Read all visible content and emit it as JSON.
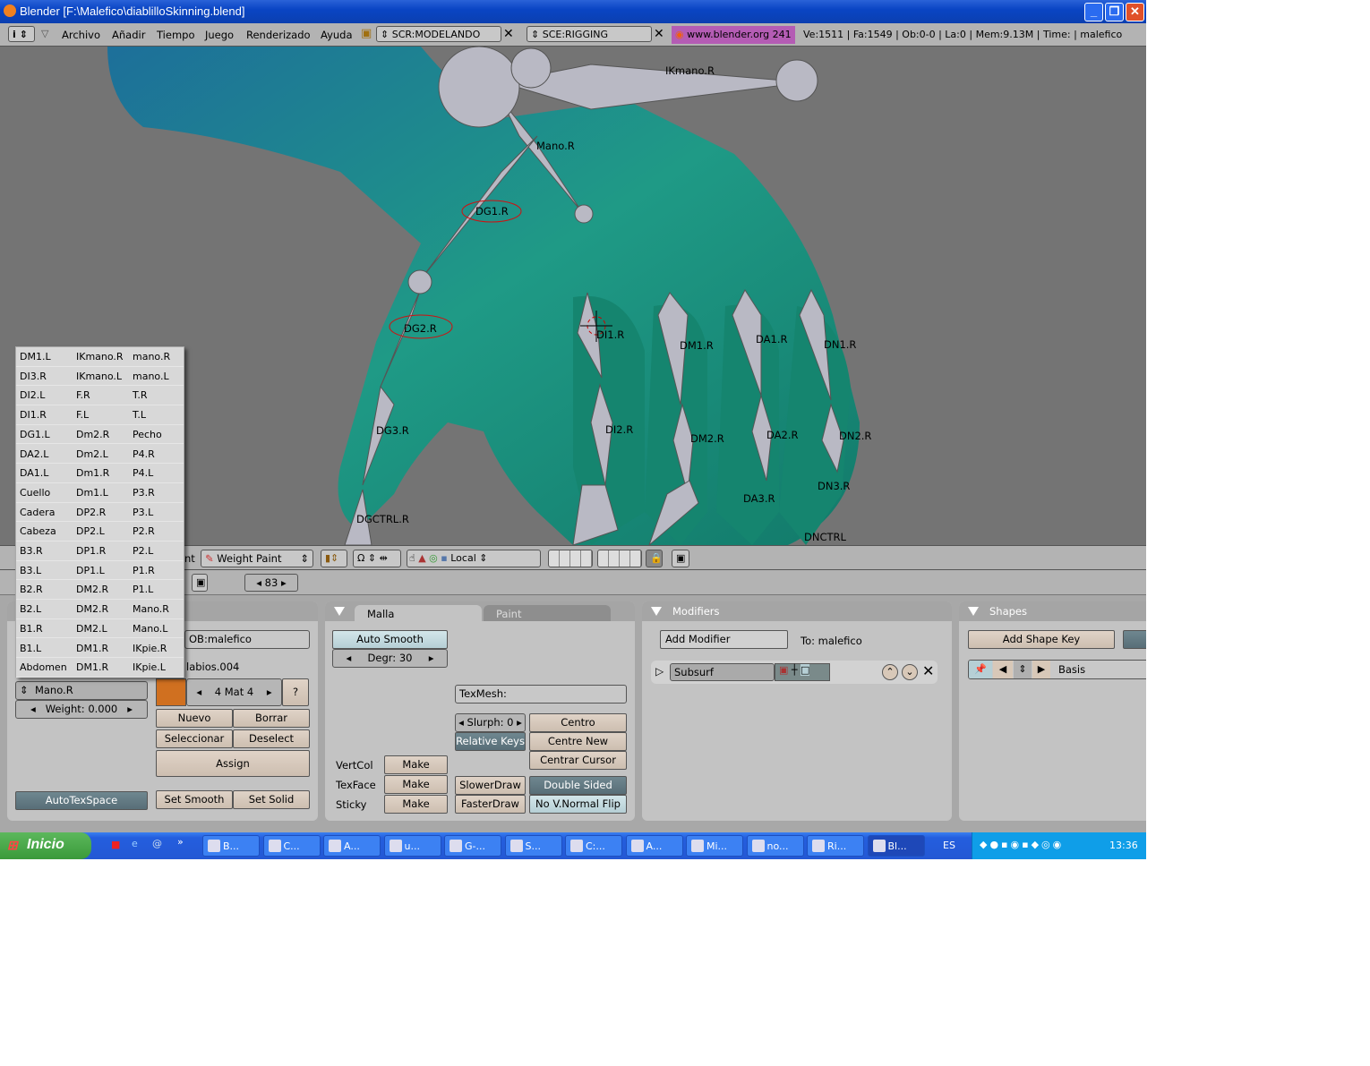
{
  "window": {
    "title": "Blender [F:\\Malefico\\diablilloSkinning.blend]",
    "buttons": [
      "minimize",
      "restore",
      "close"
    ]
  },
  "menubar": {
    "items": [
      "Archivo",
      "Añadir",
      "Tiempo",
      "Juego",
      "Renderizado",
      "Ayuda"
    ],
    "screen": "SCR:MODELANDO",
    "scene": "SCE:RIGGING",
    "link": "www.blender.org 241",
    "stats": "Ve:1511 | Fa:1549 | Ob:0-0 | La:0 | Mem:9.13M | Time: | malefico",
    "link_color": "#b45cb4"
  },
  "viewport": {
    "background": "#747474",
    "mesh_color": "#1f8a8a",
    "bones": [
      "IKmano.R",
      "Mano.R",
      "DG1.R",
      "DG2.R",
      "DI1.R",
      "DM1.R",
      "DA1.R",
      "DN1.R",
      "DG3.R",
      "DI2.R",
      "DM2.R",
      "DA2.R",
      "DN2.R",
      "DGCTRL.R",
      "DA3.R",
      "DN3.R",
      "DNCTRL"
    ]
  },
  "header3d": {
    "mode_partial": "nt",
    "mode": "Weight Paint",
    "orientation": "Local"
  },
  "buttons_header": {
    "frame": "83"
  },
  "popup": {
    "rows": [
      [
        "DM1.L",
        "IKmano.R",
        "mano.R"
      ],
      [
        "DI3.R",
        "IKmano.L",
        "mano.L"
      ],
      [
        "DI2.L",
        "F.R",
        "T.R"
      ],
      [
        "DI1.R",
        "F.L",
        "T.L"
      ],
      [
        "DG1.L",
        "Dm2.R",
        "Pecho"
      ],
      [
        "DA2.L",
        "Dm2.L",
        "P4.R"
      ],
      [
        "DA1.L",
        "Dm1.R",
        "P4.L"
      ],
      [
        "Cuello",
        "Dm1.L",
        "P3.R"
      ],
      [
        "Cadera",
        "DP2.R",
        "P3.L"
      ],
      [
        "Cabeza",
        "DP2.L",
        "P2.R"
      ],
      [
        "B3.R",
        "DP1.R",
        "P2.L"
      ],
      [
        "B3.L",
        "DP1.L",
        "P1.R"
      ],
      [
        "B2.R",
        "DM2.R",
        "P1.L"
      ],
      [
        "B2.L",
        "DM2.R",
        "Mano.R"
      ],
      [
        "B1.R",
        "DM2.L",
        "Mano.L"
      ],
      [
        "B1.L",
        "DM1.R",
        "IKpie.R"
      ],
      [
        "Abdomen",
        "DM1.R",
        "IKpie.L"
      ]
    ]
  },
  "link_panel": {
    "ob": "OB:malefico",
    "material_name": "labios.004",
    "mat": "4 Mat 4",
    "mat_help": "?",
    "material_color": "#d07020",
    "vgroup": "Mano.R",
    "weight": "Weight: 0.000",
    "nuevo": "Nuevo",
    "borrar": "Borrar",
    "seleccionar": "Seleccionar",
    "deselect": "Deselect",
    "assign": "Assign",
    "autotex": "AutoTexSpace",
    "set_smooth": "Set Smooth",
    "set_solid": "Set Solid"
  },
  "mesh_panel": {
    "tab_active": "Malla",
    "tab_inactive": "Paint",
    "auto_smooth": "Auto Smooth",
    "degr": "Degr: 30",
    "texmesh": "TexMesh:",
    "slurph": "Slurph: 0",
    "relative_keys": "Relative Keys",
    "centro": "Centro",
    "centre_new": "Centre New",
    "centrar_cursor": "Centrar Cursor",
    "vertcol": "VertCol",
    "texface": "TexFace",
    "sticky": "Sticky",
    "make": "Make",
    "slower": "SlowerDraw",
    "faster": "FasterDraw",
    "double_sided": "Double Sided",
    "no_vnormal": "No V.Normal Flip"
  },
  "modifiers_panel": {
    "title": "Modifiers",
    "add": "Add Modifier",
    "to": "To: malefico",
    "modifier": "Subsurf"
  },
  "shapes_panel": {
    "title": "Shapes",
    "add": "Add Shape Key",
    "key": "Basis"
  },
  "taskbar": {
    "start": "Inicio",
    "tasks": [
      "B...",
      "C...",
      "A...",
      "u...",
      "G-...",
      "S...",
      "C:...",
      "A...",
      "Mi...",
      "no...",
      "Ri...",
      "Bl..."
    ],
    "lang": "ES",
    "clock": "13:36"
  }
}
